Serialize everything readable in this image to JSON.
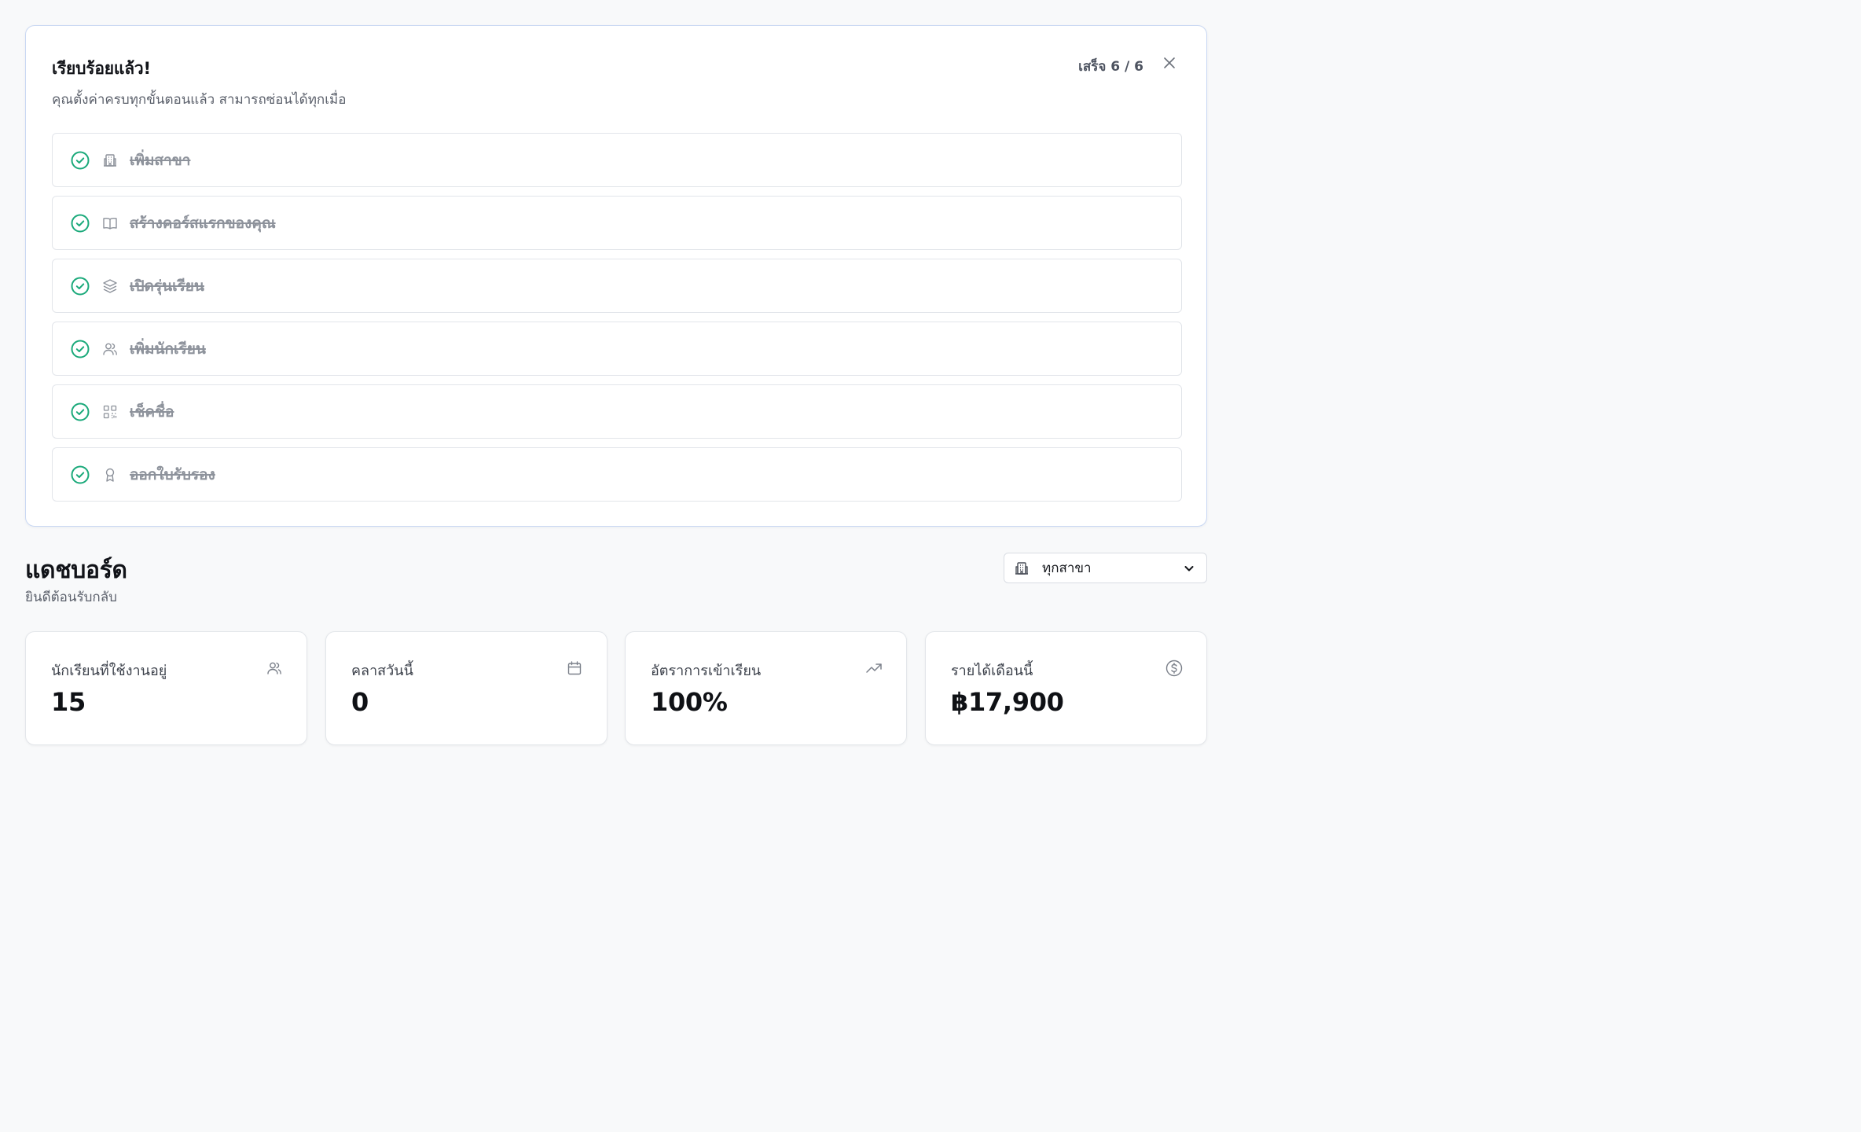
{
  "onboarding": {
    "title": "เรียบร้อยแล้ว!",
    "subtitle": "คุณตั้งค่าครบทุกขั้นตอนแล้ว สามารถซ่อนได้ทุกเมื่อ",
    "progress": "เสร็จ 6 / 6",
    "completed": 6,
    "total": 6,
    "steps": [
      {
        "label": "เพิ่มสาขา",
        "icon": "building-icon",
        "done": true
      },
      {
        "label": "สร้างคอร์สแรกของคุณ",
        "icon": "book-open-icon",
        "done": true
      },
      {
        "label": "เปิดรุ่นเรียน",
        "icon": "layers-icon",
        "done": true
      },
      {
        "label": "เพิ่มนักเรียน",
        "icon": "users-icon",
        "done": true
      },
      {
        "label": "เช็คชื่อ",
        "icon": "qr-code-icon",
        "done": true
      },
      {
        "label": "ออกใบรับรอง",
        "icon": "award-icon",
        "done": true
      }
    ]
  },
  "dashboard": {
    "title": "แดชบอร์ด",
    "subtitle": "ยินดีต้อนรับกลับ",
    "branch_select": {
      "value": "ทุกสาขา",
      "icon": "building-icon"
    }
  },
  "stats": [
    {
      "title": "นักเรียนที่ใช้งานอยู่",
      "value": "15",
      "icon": "users-icon"
    },
    {
      "title": "คลาสวันนี้",
      "value": "0",
      "icon": "calendar-icon"
    },
    {
      "title": "อัตราการเข้าเรียน",
      "value": "100%",
      "icon": "trending-up-icon"
    },
    {
      "title": "รายได้เดือนนี้",
      "value": "฿17,900",
      "icon": "dollar-circle-icon"
    }
  ],
  "colors": {
    "accent_green": "#1aa97a",
    "panel_border": "#c9d8f3",
    "muted": "#8d929b"
  }
}
